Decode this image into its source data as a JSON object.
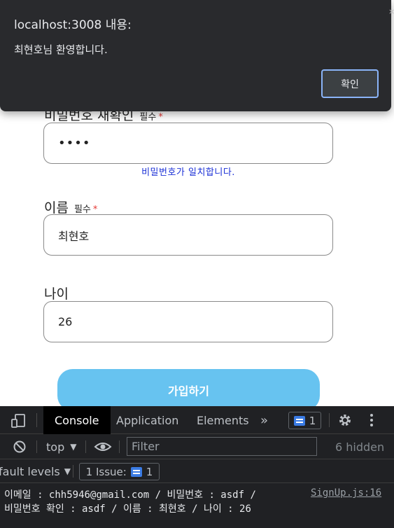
{
  "alert": {
    "title": "localhost:3008 내용:",
    "message": "최현호님 환영합니다.",
    "ok_label": "확인",
    "close": "×"
  },
  "form": {
    "confirm_password": {
      "label": "비밀번호 재확인",
      "required_text": "필수",
      "required_mark": "*",
      "value": "••••",
      "hint": "비밀번호가 일치합니다."
    },
    "name": {
      "label": "이름",
      "required_text": "필수",
      "required_mark": "*",
      "value": "최현호"
    },
    "age": {
      "label": "나이",
      "value": "26"
    },
    "submit_label": "가입하기"
  },
  "devtools": {
    "tabs": [
      "Console",
      "Application",
      "Elements"
    ],
    "more": "»",
    "issues_count": "1",
    "context": "top",
    "filter_placeholder": "Filter",
    "hidden": "6 hidden",
    "levels": "fault levels",
    "issue_label": "1 Issue:",
    "issue_count": "1",
    "log_line1": "이메일 : chh5946@gmail.com  / 비밀번호 : asdf /",
    "log_line2": "비밀번호 확인 : asdf / 이름 : 최현호 / 나이 : 26",
    "log_source": "SignUp.js:16"
  },
  "colors": {
    "accent_button": "#67c3f0",
    "hint_text": "#1a2fd6",
    "required_star": "#e53935",
    "dialog_bg": "#292a2d",
    "devtools_bg": "#202124"
  }
}
